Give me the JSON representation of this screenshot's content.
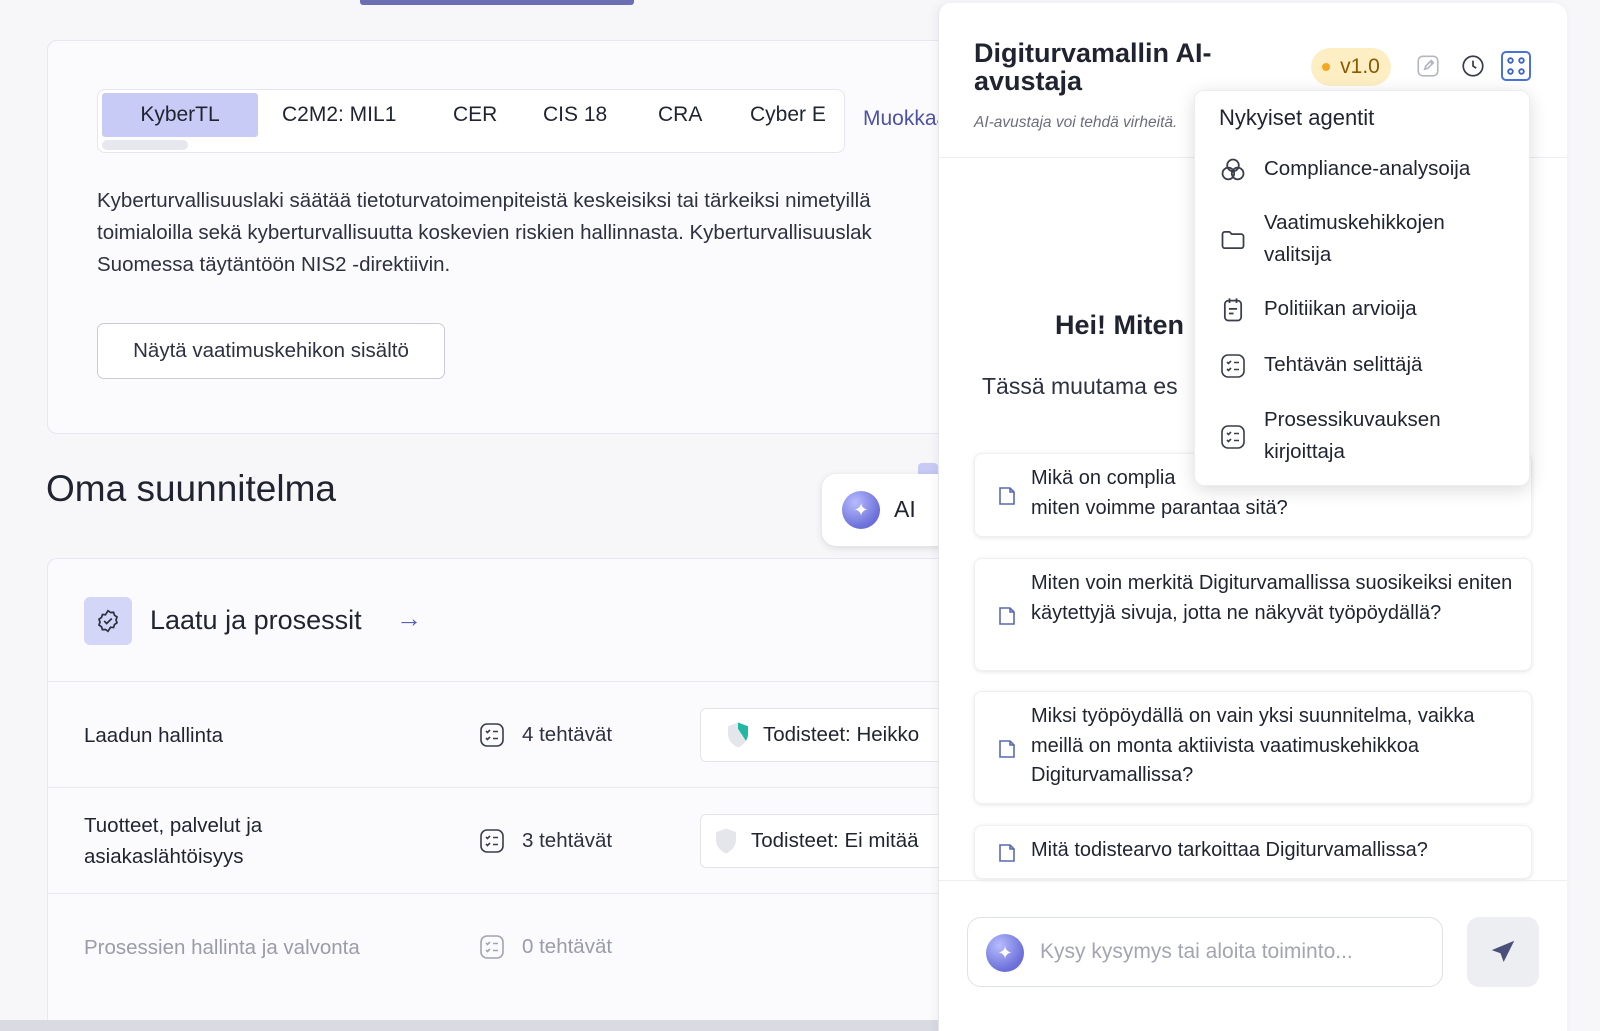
{
  "main": {
    "framework_tabs": [
      "KyberTL",
      "C2M2: MIL1",
      "CER",
      "CIS 18",
      "CRA",
      "Cyber E"
    ],
    "edit_link": "Muokkaa",
    "description_lines": [
      "Kyberturvallisuuslaki säätää tietoturvatoimenpiteistä keskeisiksi tai tärkeiksi nimetyillä",
      "toimialoilla sekä kyberturvallisuutta koskevien riskien hallinnasta. Kyberturvallisuuslak",
      "Suomessa täytäntöön NIS2 -direktiivin."
    ],
    "show_content_button": "Näytä vaatimuskehikon sisältö",
    "plan_title": "Oma suunnitelma",
    "ai_button": "AI",
    "category": {
      "title": "Laatu ja prosessit",
      "arrow": "→",
      "rows": [
        {
          "name": "Laadun hallinta",
          "tasks": "4 tehtävät",
          "evidence_label": "Todisteet:",
          "evidence_value": "Heikko",
          "evidence_color": "#1fb8a3"
        },
        {
          "name": "Tuotteet, palvelut ja asiakaslähtöisyys",
          "tasks": "3 tehtävät",
          "evidence_label": "Todisteet:",
          "evidence_value": "Ei mitää",
          "evidence_color": "#d9dbe2"
        },
        {
          "name": "Prosessien hallinta ja valvonta",
          "tasks": "0 tehtävät"
        }
      ]
    }
  },
  "panel": {
    "title": "Digiturvamallin AI-avustaja",
    "subtitle": "AI-avustaja voi tehdä virheitä.",
    "version": "v1.0",
    "icons": [
      "edit-icon",
      "history-icon",
      "agents-grid-icon"
    ],
    "greeting": "Hei! Miten",
    "greeting_sub": "Tässä muutama es",
    "suggestions": [
      "Mikä on complia",
      "miten voimme parantaa sitä?",
      "Miten voin merkitä Digiturvamallissa suosikeiksi eniten käytettyjä sivuja, jotta ne näkyvät työpöydällä?",
      "Miksi työpöydällä on vain yksi suunnitelma, vaikka meillä on monta aktiivista vaatimuskehikkoa Digiturvamallissa?",
      "Mitä todistearvo tarkoittaa Digiturvamallissa?"
    ],
    "input_placeholder": "Kysy kysymys tai aloita toiminto...",
    "send_icon": "send-icon"
  },
  "agents_menu": {
    "title": "Nykyiset agentit",
    "items": [
      {
        "label": "Compliance-analysoija",
        "icon": "circles-icon"
      },
      {
        "label": "Vaatimuskehikkojen valitsija",
        "icon": "folder-icon"
      },
      {
        "label": "Politiikan arvioija",
        "icon": "policy-icon"
      },
      {
        "label": "Tehtävän selittäjä",
        "icon": "checklist-icon"
      },
      {
        "label": "Prosessikuvauksen kirjoittaja",
        "icon": "checklist-icon"
      }
    ]
  },
  "colors": {
    "accent": "#4d51a6",
    "active_tab": "#c9cbf7",
    "badge": "#fdefc3"
  }
}
